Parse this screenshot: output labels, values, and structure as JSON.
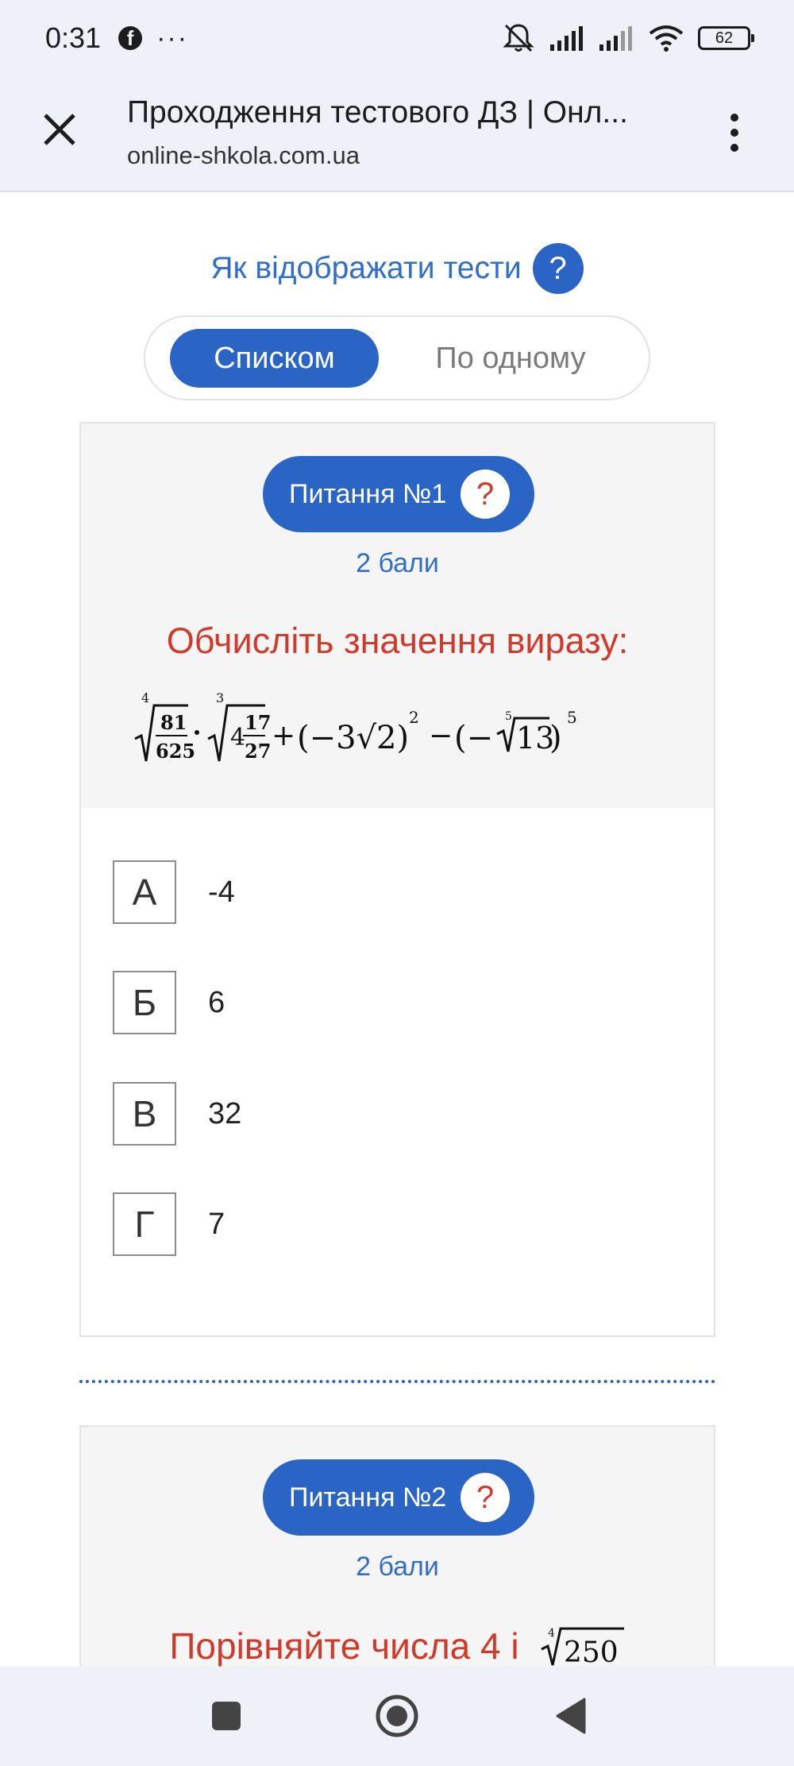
{
  "status_bar": {
    "time": "0:31",
    "dots": "···",
    "battery": "62"
  },
  "browser": {
    "title": "Проходження тестового ДЗ | Онл...",
    "url": "online-shkola.com.ua"
  },
  "display_mode": {
    "heading": "Як відображати тести",
    "help": "?",
    "options": [
      "Списком",
      "По одному"
    ],
    "selected": "Списком"
  },
  "questions": [
    {
      "badge": "Питання №1",
      "help": "?",
      "points": "2 бали",
      "text": "Обчисліть значення виразу:",
      "answers": [
        {
          "letter": "А",
          "value": "-4"
        },
        {
          "letter": "Б",
          "value": "6"
        },
        {
          "letter": "В",
          "value": "32"
        },
        {
          "letter": "Г",
          "value": "7"
        }
      ]
    },
    {
      "badge": "Питання №2",
      "help": "?",
      "points": "2 бали",
      "text": "Порівняйте числа 4 і",
      "radical_index": "4",
      "radicand": "250"
    }
  ],
  "formula": {
    "r1_index": "4",
    "r1_num": "81",
    "r1_den": "625",
    "r2_index": "3",
    "r2_whole": "4",
    "r2_num": "17",
    "r2_den": "27",
    "t3": "(−3√2)",
    "t3_exp": "2",
    "t4_index": "5",
    "t4_rad": "13",
    "t4_exp": "5"
  }
}
